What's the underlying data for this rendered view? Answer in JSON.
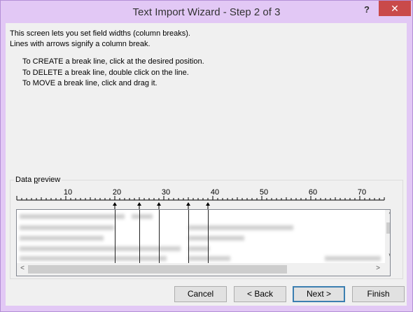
{
  "window": {
    "title": "Text Import Wizard - Step 2 of 3",
    "help_label": "?",
    "close_label": "✕"
  },
  "intro": {
    "line1": "This screen lets you set field widths (column breaks).",
    "line2": "Lines with arrows signify a column break."
  },
  "instructions": {
    "create": "To CREATE a break line, click at the desired position.",
    "delete": "To DELETE a break line, double click on the line.",
    "move": "To MOVE a break line, click and drag it."
  },
  "preview": {
    "label_prefix": "Data ",
    "label_underlined": "p",
    "label_suffix": "review",
    "ruler_ticks": [
      "10",
      "20",
      "30",
      "40",
      "50",
      "60",
      "70"
    ],
    "break_columns": [
      20,
      25,
      29,
      35,
      39
    ],
    "scroll_up": "^",
    "scroll_down": "v",
    "scroll_left": "<",
    "scroll_right": ">"
  },
  "buttons": {
    "cancel": "Cancel",
    "back": "< Back",
    "next": "Next >",
    "finish": "Finish"
  },
  "colors": {
    "title_bar": "#e2c8f5",
    "close_button": "#c94a4a",
    "dialog_body": "#f0f0f0",
    "default_button_border": "#3c7fb1"
  }
}
